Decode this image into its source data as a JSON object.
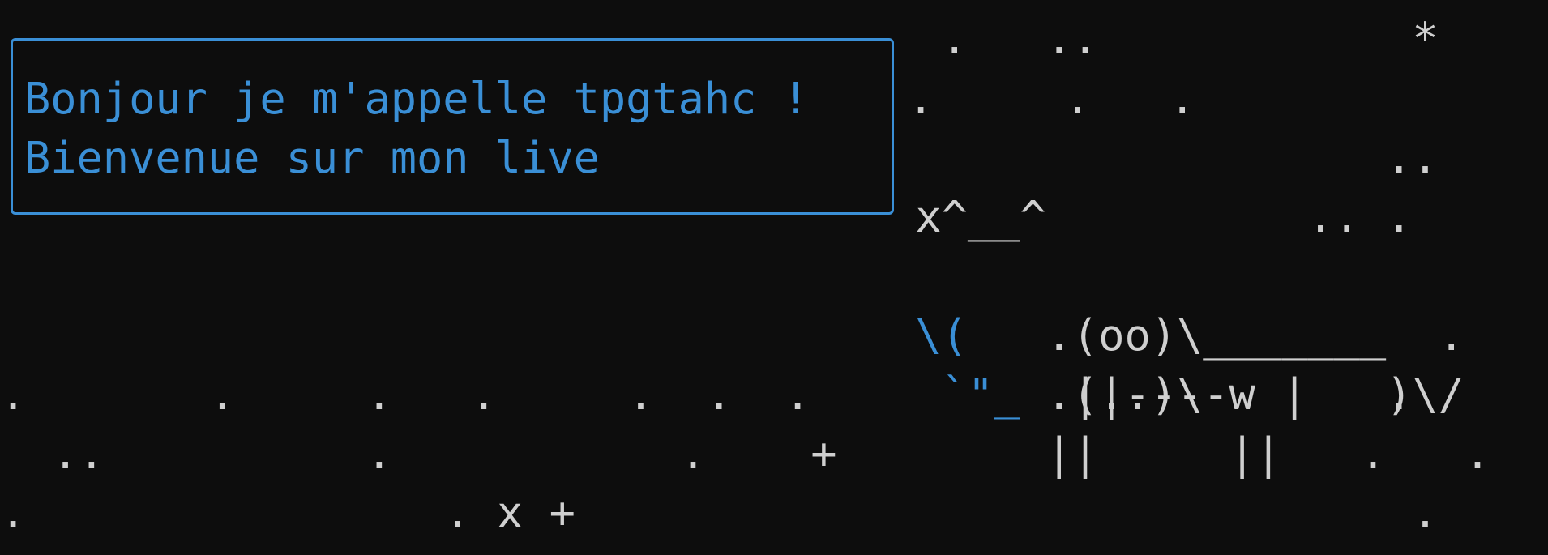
{
  "colors": {
    "background": "#0d0d0d",
    "text": "#cfcfcf",
    "accent": "#3a8fd6"
  },
  "bubble": {
    "line1": "Bonjour je m'appelle tpgtahc !",
    "line2": "Bienvenue sur mon live"
  },
  "scene": {
    "row0": "                                    .   ..            *",
    "row1_right": ".     .   .",
    "row2": "                                                     ..",
    "row3": "                                   x^__^          .. .",
    "row4_arm": "                               \\(",
    "row4_body": "   .(oo)\\_______  .",
    "row5_arm": "                                `\"_",
    "row5_body": " .(..)\\       )\\/     +",
    "row6": ".       .     .   .     .  .  .          ||----w |   .",
    "row7": "  ..          .           .    +        ||     ||   .   .",
    "row8": ".                . x +                                .    ."
  }
}
